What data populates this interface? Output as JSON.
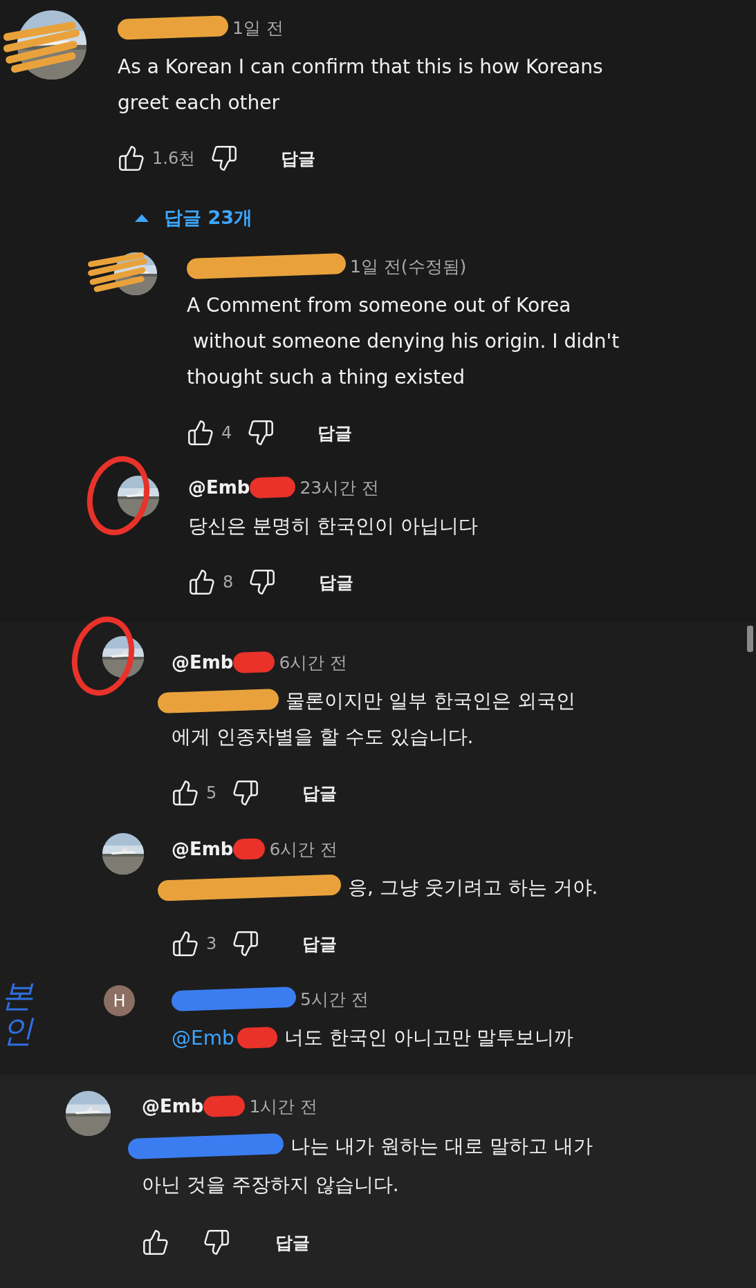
{
  "sections": [
    {
      "comments": [
        {
          "avatar": {
            "kind": "photo",
            "scribbled": true
          },
          "header": [
            {
              "kind": "mark",
              "color": "#e9a23b"
            }
          ],
          "time": "1일 전",
          "lines": [
            [
              {
                "kind": "text",
                "text": "As a Korean I can confirm that this is how Koreans"
              }
            ],
            [
              {
                "kind": "text",
                "text": "greet each other"
              }
            ]
          ],
          "likes": "1.6천",
          "reply": "답글",
          "toggle": {
            "label": "답글 23개",
            "expanded": true
          }
        },
        {
          "avatar": {
            "kind": "photo",
            "scribbled": true
          },
          "header": [
            {
              "kind": "mark",
              "color": "#e9a23b"
            }
          ],
          "time": "1일 전(수정됨)",
          "lines": [
            [
              {
                "kind": "text",
                "text": "A Comment from someone out of Korea"
              }
            ],
            [
              {
                "kind": "text",
                "text": " without someone denying his origin. I didn't"
              }
            ],
            [
              {
                "kind": "text",
                "text": "thought such a thing existed"
              }
            ]
          ],
          "likes": "4",
          "reply": "답글"
        },
        {
          "avatar": {
            "kind": "photo"
          },
          "circled": true,
          "header": [
            {
              "kind": "text",
              "text": "@Emb"
            },
            {
              "kind": "mark",
              "color": "#e8322a"
            }
          ],
          "time": "23시간 전",
          "lines": [
            [
              {
                "kind": "text",
                "text": "당신은 분명히 한국인이 아닙니다"
              }
            ]
          ],
          "likes": "8",
          "reply": "답글"
        }
      ]
    },
    {
      "comments": [
        {
          "avatar": {
            "kind": "photo"
          },
          "circled": true,
          "header": [
            {
              "kind": "text",
              "text": "@Emb"
            },
            {
              "kind": "mark",
              "color": "#e8322a"
            }
          ],
          "time": "6시간 전",
          "lines": [
            [
              {
                "kind": "mark",
                "color": "#e9a23b"
              },
              {
                "kind": "text",
                "text": "물론이지만 일부 한국인은 외국인"
              }
            ],
            [
              {
                "kind": "text",
                "text": "에게 인종차별을 할 수도 있습니다."
              }
            ]
          ],
          "likes": "5",
          "reply": "답글"
        },
        {
          "avatar": {
            "kind": "photo"
          },
          "header": [
            {
              "kind": "text",
              "text": "@Emb"
            },
            {
              "kind": "mark",
              "color": "#e8322a"
            }
          ],
          "time": "6시간 전",
          "lines": [
            [
              {
                "kind": "mark",
                "color": "#e9a23b"
              },
              {
                "kind": "text",
                "text": "응, 그냥 웃기려고 하는 거야."
              }
            ]
          ],
          "likes": "3",
          "reply": "답글"
        },
        {
          "avatar": {
            "kind": "letter",
            "letter": "H"
          },
          "header": [
            {
              "kind": "mark",
              "color": "#3b7df0"
            }
          ],
          "time": "5시간 전",
          "lines": [
            [
              {
                "kind": "mention",
                "text": "@Emb"
              },
              {
                "kind": "mark",
                "color": "#e8322a"
              },
              {
                "kind": "text",
                "text": "너도 한국인 아니고만 말투보니까"
              }
            ]
          ]
        }
      ],
      "note": "본인"
    },
    {
      "comments": [
        {
          "avatar": {
            "kind": "photo"
          },
          "header": [
            {
              "kind": "text",
              "text": "@Emb"
            },
            {
              "kind": "mark",
              "color": "#e8322a"
            }
          ],
          "time": "1시간 전",
          "lines": [
            [
              {
                "kind": "mark",
                "color": "#3b7df0"
              },
              {
                "kind": "text",
                "text": "나는 내가 원하는 대로 말하고 내가"
              }
            ],
            [
              {
                "kind": "text",
                "text": "아닌 것을 주장하지 않습니다."
              }
            ]
          ],
          "reply": "답글"
        }
      ]
    }
  ]
}
